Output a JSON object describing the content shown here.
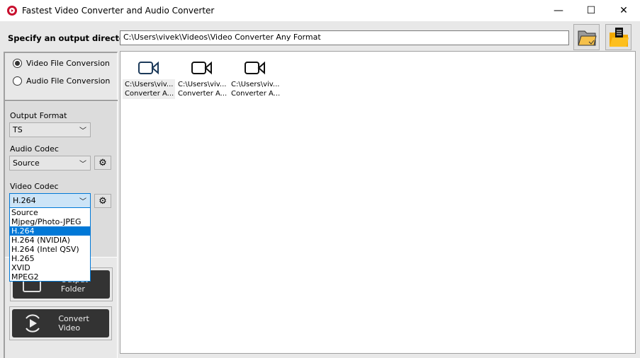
{
  "window": {
    "title": "Fastest Video Converter and Audio Converter",
    "controls": [
      "minimize",
      "maximize",
      "close"
    ]
  },
  "toolbar": {
    "dir_label": "Specify an output directory",
    "dir_value": "C:\\Users\\vivek\\Videos\\Video Converter Any Format",
    "browse_icon": "folder-check-icon",
    "open_icon": "folder-document-icon"
  },
  "mode": {
    "video": "Video File Conversion",
    "audio": "Audio File Conversion",
    "selected": "video"
  },
  "format": {
    "output_label": "Output Format",
    "output_value": "TS",
    "audio_label": "Audio Codec",
    "audio_value": "Source",
    "video_label": "Video Codec",
    "video_value": "H.264",
    "video_options": [
      "Source",
      "Mjpeg/Photo-JPEG",
      "H.264",
      "H.264 (NVIDIA)",
      "H.264 (Intel QSV)",
      "H.265",
      "XVID",
      "MPEG2"
    ]
  },
  "buttons": {
    "output_folder": "Output Folder",
    "convert": "Convert Video"
  },
  "files": [
    {
      "line1": "C:\\Users\\viv...",
      "line2": "Converter A..."
    },
    {
      "line1": "C:\\Users\\viv...",
      "line2": "Converter A..."
    },
    {
      "line1": "C:\\Users\\viv...",
      "line2": "Converter A..."
    }
  ],
  "colors": {
    "accent": "#0078d7",
    "button_dark": "#333333",
    "folder": "#f5c04a"
  }
}
